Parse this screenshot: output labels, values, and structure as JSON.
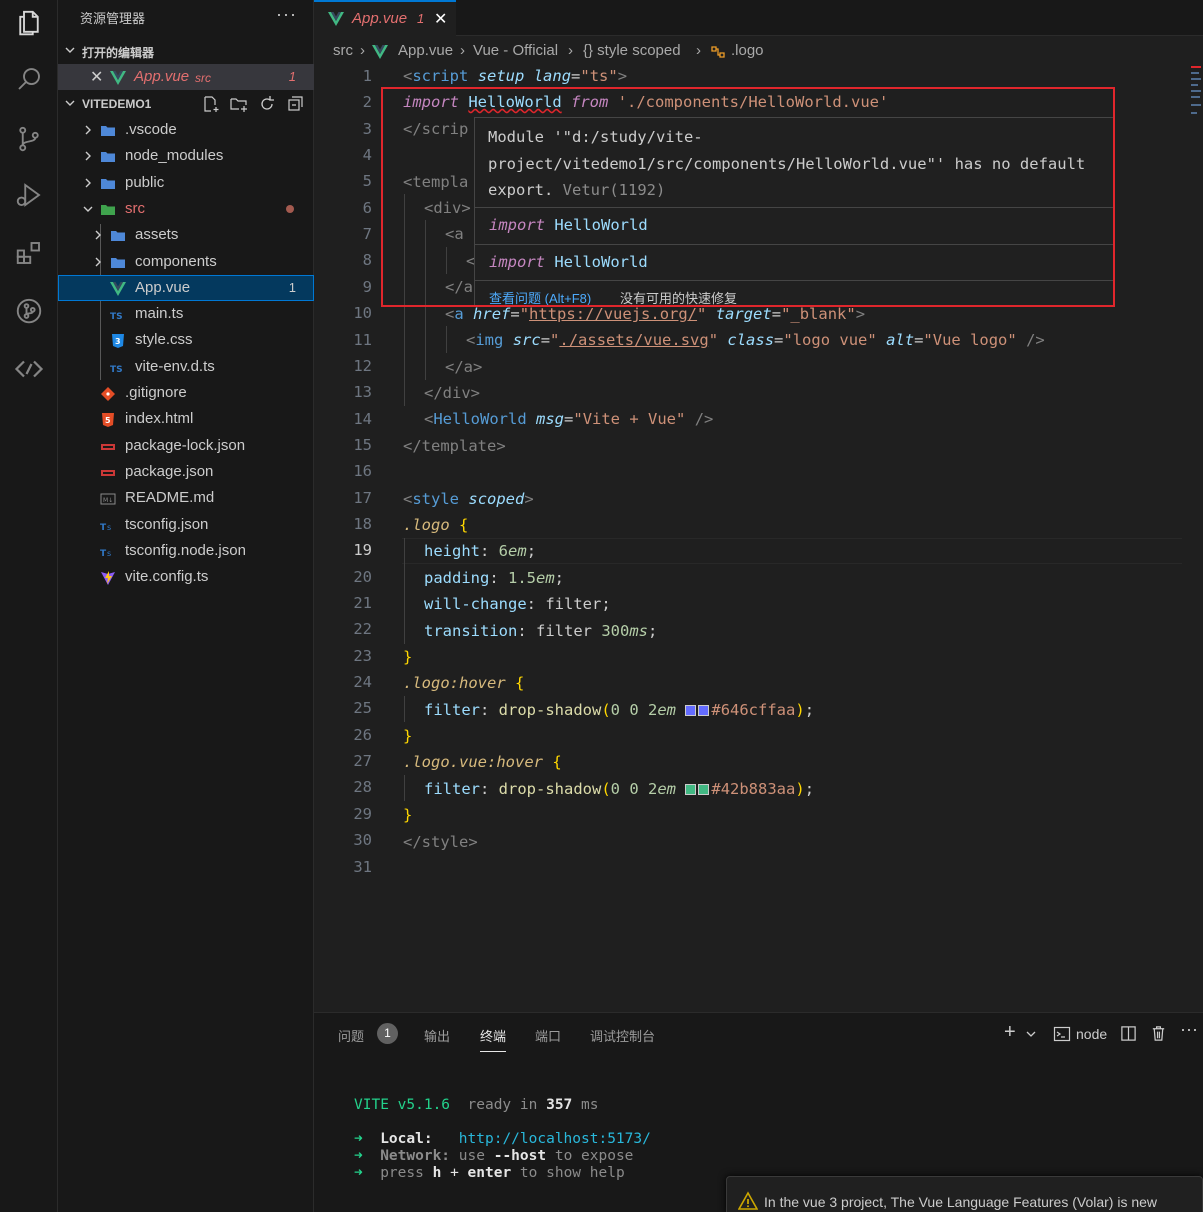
{
  "activity_bar": {
    "icons": [
      "explorer-icon",
      "search-icon",
      "source-control-icon",
      "run-debug-icon",
      "extensions-icon",
      "git-graph-icon",
      "remote-icon"
    ]
  },
  "sidebar": {
    "title": "资源管理器",
    "more": "···",
    "open_editors_label": "打开的编辑器",
    "open_editor": {
      "name": "App.vue",
      "folder": "src",
      "problems": "1"
    },
    "project_label": "VITEDEMO1",
    "tree": [
      {
        "name": ".vscode",
        "kind": "folder",
        "depth": 1
      },
      {
        "name": "node_modules",
        "kind": "folder",
        "depth": 1
      },
      {
        "name": "public",
        "kind": "folder",
        "depth": 1
      },
      {
        "name": "src",
        "kind": "folder-open",
        "depth": 1
      },
      {
        "name": "assets",
        "kind": "folder",
        "depth": 2
      },
      {
        "name": "components",
        "kind": "folder",
        "depth": 2
      },
      {
        "name": "App.vue",
        "kind": "vue",
        "depth": 2,
        "problems": "1"
      },
      {
        "name": "main.ts",
        "kind": "ts",
        "depth": 2
      },
      {
        "name": "style.css",
        "kind": "css",
        "depth": 2
      },
      {
        "name": "vite-env.d.ts",
        "kind": "ts",
        "depth": 2
      },
      {
        "name": ".gitignore",
        "kind": "git",
        "depth": 1
      },
      {
        "name": "index.html",
        "kind": "html",
        "depth": 1
      },
      {
        "name": "package-lock.json",
        "kind": "npm",
        "depth": 1
      },
      {
        "name": "package.json",
        "kind": "npm",
        "depth": 1
      },
      {
        "name": "README.md",
        "kind": "md",
        "depth": 1
      },
      {
        "name": "tsconfig.json",
        "kind": "tsconfig",
        "depth": 1
      },
      {
        "name": "tsconfig.node.json",
        "kind": "tsconfig",
        "depth": 1
      },
      {
        "name": "vite.config.ts",
        "kind": "vite",
        "depth": 1
      }
    ]
  },
  "tab": {
    "name": "App.vue",
    "problems": "1",
    "close": "✕"
  },
  "breadcrumb": {
    "a": "src",
    "b": "App.vue",
    "c": "Vue - Official",
    "d": "{} style scoped",
    "e": ".logo"
  },
  "editor": {
    "line_numbers": [
      "1",
      "2",
      "3",
      "4",
      "5",
      "6",
      "7",
      "8",
      "9",
      "10",
      "11",
      "12",
      "13",
      "14",
      "15",
      "16",
      "17",
      "18",
      "19",
      "20",
      "21",
      "22",
      "23",
      "24",
      "25",
      "26",
      "27",
      "28",
      "29",
      "30",
      "31"
    ],
    "active_line": "19",
    "l1": {
      "open": "<",
      "tag": "script",
      "a1": "setup",
      "a2": "lang",
      "v": "\"ts\"",
      "close": ">"
    },
    "l2": {
      "kw1": "import",
      "id": "HelloWorld",
      "kw2": "from",
      "path": "'./components/HelloWorld.vue'"
    },
    "l3": "</scrip",
    "l5": "<templa",
    "l6": "<div>",
    "l7": "<a",
    "l8": "<",
    "l9": "</a",
    "l10": {
      "tag": "a",
      "a1": "href",
      "v1": "https://vuejs.org/",
      "a2": "target",
      "v2": "\"_blank\""
    },
    "l11": {
      "tag": "img",
      "a1": "src",
      "v1": "./assets/vue.svg",
      "a2": "class",
      "v2": "\"logo vue\"",
      "a3": "alt",
      "v3": "\"Vue logo\"",
      "end": "/>"
    },
    "l12": "</a>",
    "l13": "</div>",
    "l14": {
      "tag": "HelloWorld",
      "a1": "msg",
      "v1": "\"Vite + Vue\"",
      "end": "/>"
    },
    "l15": "</template>",
    "l17": {
      "tag": "style",
      "a1": "scoped"
    },
    "l18": ".logo",
    "l19": {
      "p": "height",
      "n": "6",
      "u": "em"
    },
    "l20": {
      "p": "padding",
      "n": "1.5",
      "u": "em"
    },
    "l21": {
      "p": "will-change",
      "v": "filter"
    },
    "l22": {
      "p": "transition",
      "v": "filter",
      "n": "300",
      "u": "ms"
    },
    "l24": ".logo:hover",
    "l25": {
      "p": "filter",
      "fn": "drop-shadow",
      "args": "0 0 ",
      "n": "2",
      "u": "em",
      "color": "#646cffaa"
    },
    "l27": ".logo.vue:hover",
    "l28": {
      "p": "filter",
      "fn": "drop-shadow",
      "args": "0 0 ",
      "n": "2",
      "u": "em",
      "color": "#42b883aa"
    },
    "l30": "</style>",
    "swatch_colors": {
      "purple": "#646cff",
      "green": "#42b883"
    }
  },
  "hover": {
    "message": "Module '\"d:/study/vite-project/vitedemo1/src/components/HelloWorld.vue\"' has no default export.",
    "source": "Vetur(1192)",
    "suggestion_kw": "import",
    "suggestion_id": "HelloWorld",
    "view_problem": "查看问题 (Alt+F8)",
    "no_quickfix": "没有可用的快速修复"
  },
  "panel": {
    "tabs": {
      "problems": "问题",
      "problems_count": "1",
      "output": "输出",
      "terminal": "终端",
      "ports": "端口",
      "debug_console": "调试控制台"
    },
    "node_label": "node",
    "terminal": {
      "vite": "VITE",
      "version": "v5.1.6",
      "ready": "ready in",
      "ms": "357",
      "ms_unit": "ms",
      "local_label": "Local:",
      "local_url": "http://localhost:5173/",
      "network_label": "Network:",
      "network_text1": "use",
      "network_flag": "--host",
      "network_text2": "to expose",
      "help_text1": "press",
      "help_key1": "h",
      "help_plus": "+",
      "help_key2": "enter",
      "help_text2": "to show help"
    }
  },
  "toast": {
    "message": "In the vue 3 project, The Vue Language Features (Volar) is new"
  }
}
